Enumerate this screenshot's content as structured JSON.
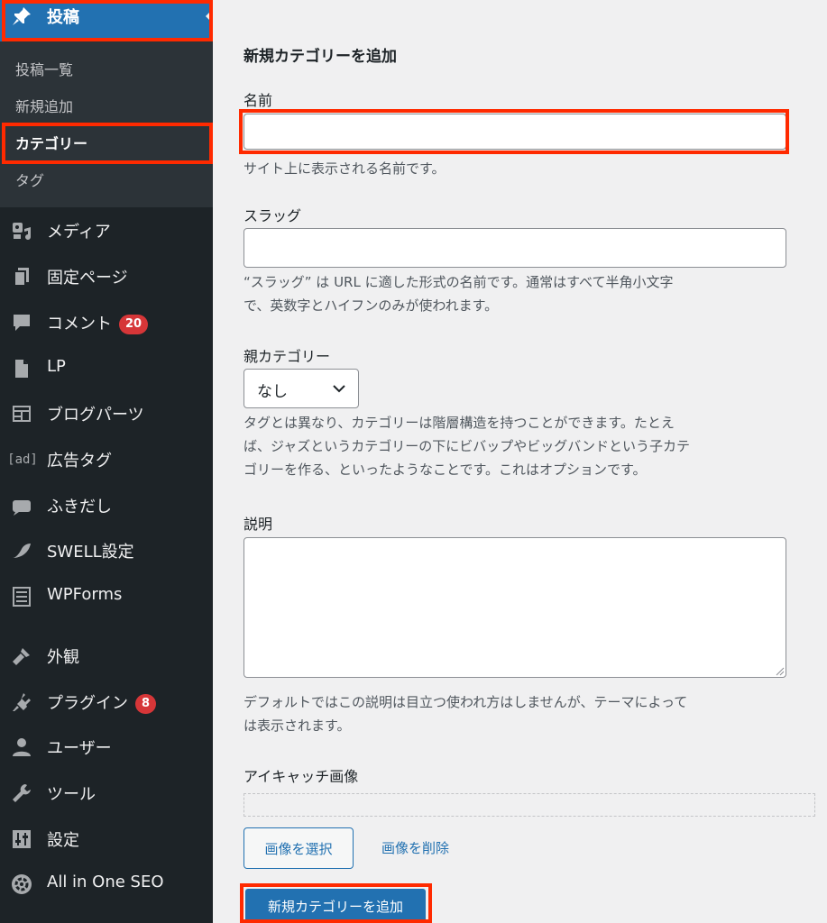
{
  "sidebar": {
    "posts": {
      "label": "投稿",
      "icon": "pushpin-icon"
    },
    "submenu": [
      {
        "label": "投稿一覧",
        "current": false
      },
      {
        "label": "新規追加",
        "current": false
      },
      {
        "label": "カテゴリー",
        "current": true
      },
      {
        "label": "タグ",
        "current": false
      }
    ],
    "items": [
      {
        "label": "メディア",
        "icon": "media-icon"
      },
      {
        "label": "固定ページ",
        "icon": "pages-icon"
      },
      {
        "label": "コメント",
        "icon": "comment-icon",
        "badge": "20"
      },
      {
        "label": "LP",
        "icon": "document-icon"
      },
      {
        "label": "ブログパーツ",
        "icon": "layout-icon"
      },
      {
        "label": "広告タグ",
        "icon": "ad-icon",
        "icon_text": "[ad]"
      },
      {
        "label": "ふきだし",
        "icon": "speech-bubble-icon"
      },
      {
        "label": "SWELL設定",
        "icon": "swell-icon"
      },
      {
        "label": "WPForms",
        "icon": "forms-icon"
      },
      {
        "label": "外観",
        "icon": "paintbrush-icon"
      },
      {
        "label": "プラグイン",
        "icon": "plugin-icon",
        "badge": "8"
      },
      {
        "label": "ユーザー",
        "icon": "user-icon"
      },
      {
        "label": "ツール",
        "icon": "wrench-icon"
      },
      {
        "label": "設定",
        "icon": "settings-icon"
      },
      {
        "label": "All in One SEO",
        "icon": "aioseo-icon"
      }
    ]
  },
  "form": {
    "heading": "新規カテゴリーを追加",
    "name": {
      "label": "名前",
      "value": "",
      "help": "サイト上に表示される名前です。"
    },
    "slug": {
      "label": "スラッグ",
      "value": "",
      "help_line1": "“スラッグ” は URL に適した形式の名前です。通常はすべて半角小文字",
      "help_line2": "で、英数字とハイフンのみが使われます。"
    },
    "parent": {
      "label": "親カテゴリー",
      "selected": "なし",
      "help_line1": "タグとは異なり、カテゴリーは階層構造を持つことができます。たとえ",
      "help_line2": "ば、ジャズというカテゴリーの下にビバップやビッグバンドという子カテ",
      "help_line3": "ゴリーを作る、といったようなことです。これはオプションです。"
    },
    "description": {
      "label": "説明",
      "value": "",
      "help_line1": "デフォルトではこの説明は目立つ使われ方はしませんが、テーマによって",
      "help_line2": "は表示されます。"
    },
    "eyecatch": {
      "label": "アイキャッチ画像",
      "select_button": "画像を選択",
      "remove_link": "画像を削除"
    },
    "submit": "新規カテゴリーを追加"
  },
  "colors": {
    "sidebar_bg": "#1d2327",
    "submenu_bg": "#2c3338",
    "accent": "#2271b1",
    "badge": "#d63638",
    "highlight_box": "#ff2a00",
    "page_bg": "#f0f0f1"
  }
}
